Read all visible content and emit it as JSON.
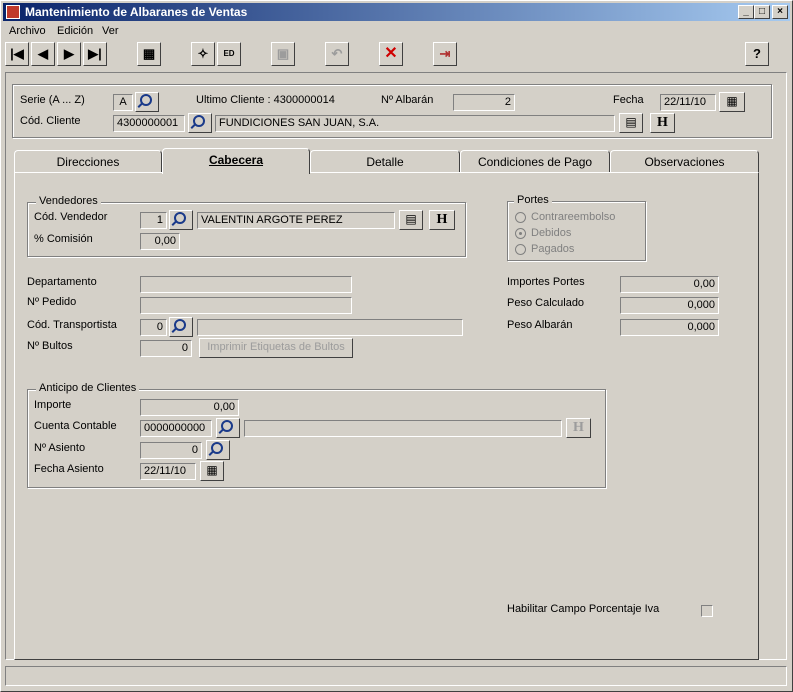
{
  "window": {
    "title": "Mantenimiento de Albaranes de Ventas",
    "controls": {
      "minimize": "_",
      "maximize": "□",
      "close": "×"
    }
  },
  "menu": [
    "Archivo",
    "Edición",
    "Ver"
  ],
  "header": {
    "serie_label": "Serie (A ... Z)",
    "serie_value": "A",
    "ultimo_cliente": "Ultimo Cliente : 4300000014",
    "albaran_label": "Nº Albarán",
    "albaran_value": "2",
    "fecha_label": "Fecha",
    "fecha_value": "22/11/10",
    "cliente_label": "Cód. Cliente",
    "cliente_code": "4300000001",
    "cliente_name": "FUNDICIONES SAN JUAN, S.A.",
    "h_label": "H"
  },
  "tabs": [
    "Direcciones",
    "Cabecera",
    "Detalle",
    "Condiciones de Pago",
    "Observaciones"
  ],
  "vendedores": {
    "title": "Vendedores",
    "codigo_label": "Cód. Vendedor",
    "codigo_value": "1",
    "nombre_value": "VALENTIN ARGOTE PEREZ",
    "comision_label": "% Comisión",
    "comision_value": "0,00",
    "h_label": "H"
  },
  "portes": {
    "title": "Portes",
    "options": [
      "Contrareembolso",
      "Debidos",
      "Pagados"
    ],
    "selected": "Debidos"
  },
  "fields": {
    "departamento_label": "Departamento",
    "pedido_label": "Nº Pedido",
    "transportista_label": "Cód. Transportista",
    "transportista_value": "0",
    "bultos_label": "Nº Bultos",
    "bultos_value": "0",
    "imprimir_label": "Imprimir Etiquetas de Bultos",
    "importes_portes_label": "Importes Portes",
    "importes_portes_value": "0,00",
    "peso_calculado_label": "Peso Calculado",
    "peso_calculado_value": "0,000",
    "peso_albaran_label": "Peso Albarán",
    "peso_albaran_value": "0,000"
  },
  "anticipo": {
    "title": "Anticipo de Clientes",
    "importe_label": "Importe",
    "importe_value": "0,00",
    "cuenta_label": "Cuenta Contable",
    "cuenta_value": "0000000000",
    "asiento_label": "Nº Asiento",
    "asiento_value": "0",
    "fecha_label": "Fecha Asiento",
    "fecha_value": "22/11/10",
    "h_label": "H"
  },
  "iva": {
    "label": "Habilitar Campo Porcentaje Iva"
  }
}
